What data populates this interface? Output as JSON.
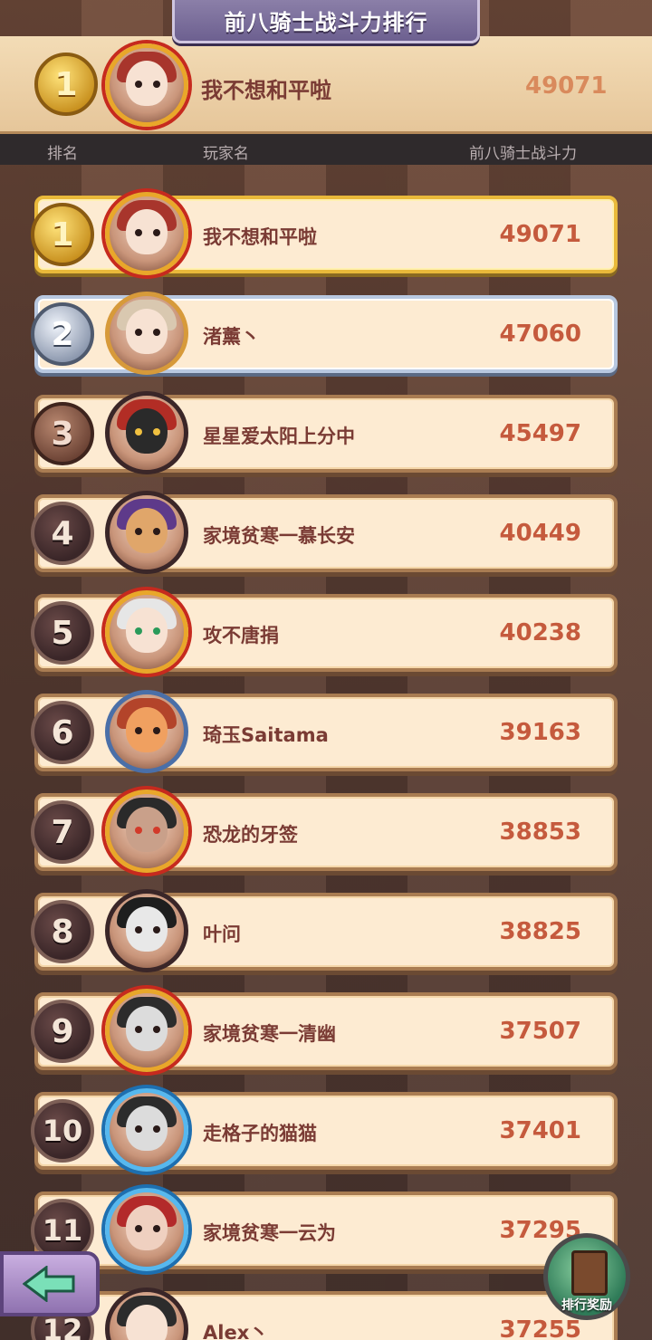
{
  "title": "前八骑士战斗力排行",
  "my_rank": {
    "rank": "1",
    "name": "我不想和平啦",
    "power": "49071"
  },
  "headers": {
    "rank": "排名",
    "player": "玩家名",
    "power": "前八骑士战斗力"
  },
  "rows": [
    {
      "rank": "1",
      "name": "我不想和平啦",
      "power": "49071"
    },
    {
      "rank": "2",
      "name": "渚薰丶",
      "power": "47060"
    },
    {
      "rank": "3",
      "name": "星星爱太阳上分中",
      "power": "45497"
    },
    {
      "rank": "4",
      "name": "家境贫寒一慕长安",
      "power": "40449"
    },
    {
      "rank": "5",
      "name": "攻不唐捐",
      "power": "40238"
    },
    {
      "rank": "6",
      "name": "琦玉Saitama",
      "power": "39163"
    },
    {
      "rank": "7",
      "name": "恐龙的牙签",
      "power": "38853"
    },
    {
      "rank": "8",
      "name": "叶问",
      "power": "38825"
    },
    {
      "rank": "9",
      "name": "家境贫寒一清幽",
      "power": "37507"
    },
    {
      "rank": "10",
      "name": "走格子的猫猫",
      "power": "37401"
    },
    {
      "rank": "11",
      "name": "家境贫寒一云为",
      "power": "37295"
    },
    {
      "rank": "12",
      "name": "Alex丶",
      "power": "37255"
    }
  ],
  "buttons": {
    "back_icon": "back-arrow-icon",
    "reward_label": "排行奖励"
  }
}
